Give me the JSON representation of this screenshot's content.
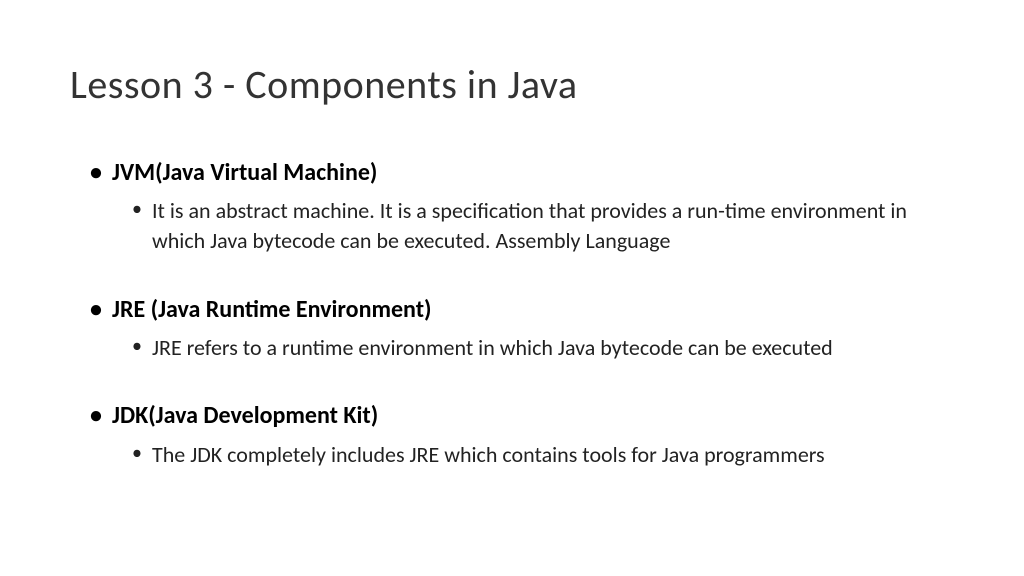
{
  "title": "Lesson 3 - Components in Java",
  "items": [
    {
      "heading": "JVM(Java Virtual Machine)",
      "description": "It is an abstract machine. It is a specification that provides a run-time environment in which Java bytecode can be executed. Assembly Language"
    },
    {
      "heading": "JRE (Java Runtime Environment)",
      "description": "JRE refers to a runtime environment in which Java bytecode can be executed"
    },
    {
      "heading": "JDK(Java Development Kit)",
      "description": "The JDK completely includes JRE which contains tools for Java programmers"
    }
  ]
}
